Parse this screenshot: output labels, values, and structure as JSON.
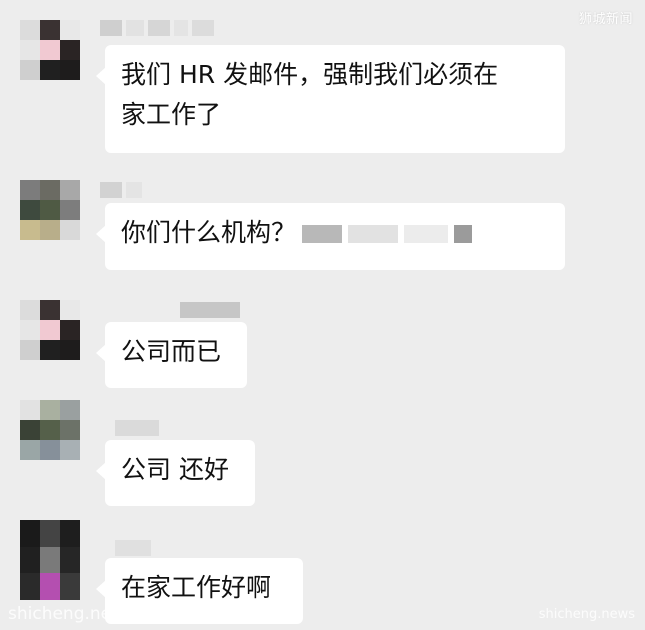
{
  "watermarks": {
    "top_right": "狮城新闻",
    "bottom_left": "shicheng.ne",
    "bottom_right": "shicheng.news"
  },
  "messages": [
    {
      "text": "我们 HR 发邮件，强制我们必须在\n家工作了"
    },
    {
      "text": "你们什么机构？"
    },
    {
      "text": "公司而已"
    },
    {
      "text": "公司 还好"
    },
    {
      "text": "在家工作好啊"
    }
  ]
}
